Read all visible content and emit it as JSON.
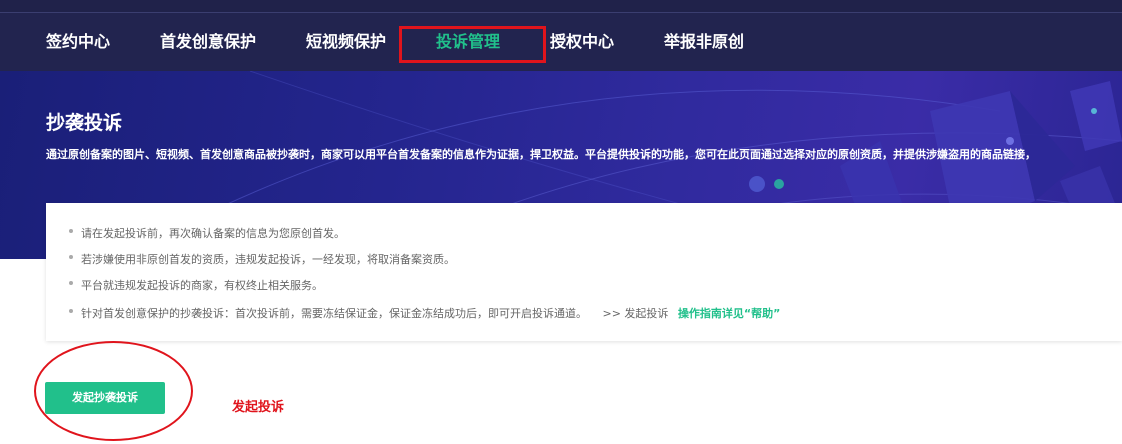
{
  "nav": {
    "items": [
      {
        "label": "签约中心"
      },
      {
        "label": "首发创意保护"
      },
      {
        "label": "短视频保护"
      },
      {
        "label": "投诉管理",
        "active": true
      },
      {
        "label": "授权中心"
      },
      {
        "label": "举报非原创"
      }
    ]
  },
  "banner": {
    "title": "抄袭投诉",
    "description": "通过原创备案的图片、短视频、首发创意商品被抄袭时，商家可以用平台首发备案的信息作为证据，捍卫权益。平台提供投诉的功能，您可在此页面通过选择对应的原创资质，并提供涉嫌盗用的商品链接，"
  },
  "notice": {
    "items": [
      "请在发起投诉前，再次确认备案的信息为您原创首发。",
      "若涉嫌使用非原创首发的资质，违规发起投诉，一经发现，将取消备案资质。",
      "平台就违规发起投诉的商家，有权终止相关服务。",
      "针对首发创意保护的抄袭投诉：首次投诉前，需要冻结保证金，保证金冻结成功后，即可开启投诉通道。"
    ],
    "arrow_text": ">>  发起投诉",
    "guide_link": "操作指南详见“帮助”"
  },
  "action": {
    "button_label": "发起抄袭投诉",
    "annotation": "发起投诉"
  },
  "colors": {
    "accent": "#21c08b",
    "nav_bg": "#22244f",
    "annotation_red": "#e0141c",
    "banner_bg": "#2a2794"
  }
}
